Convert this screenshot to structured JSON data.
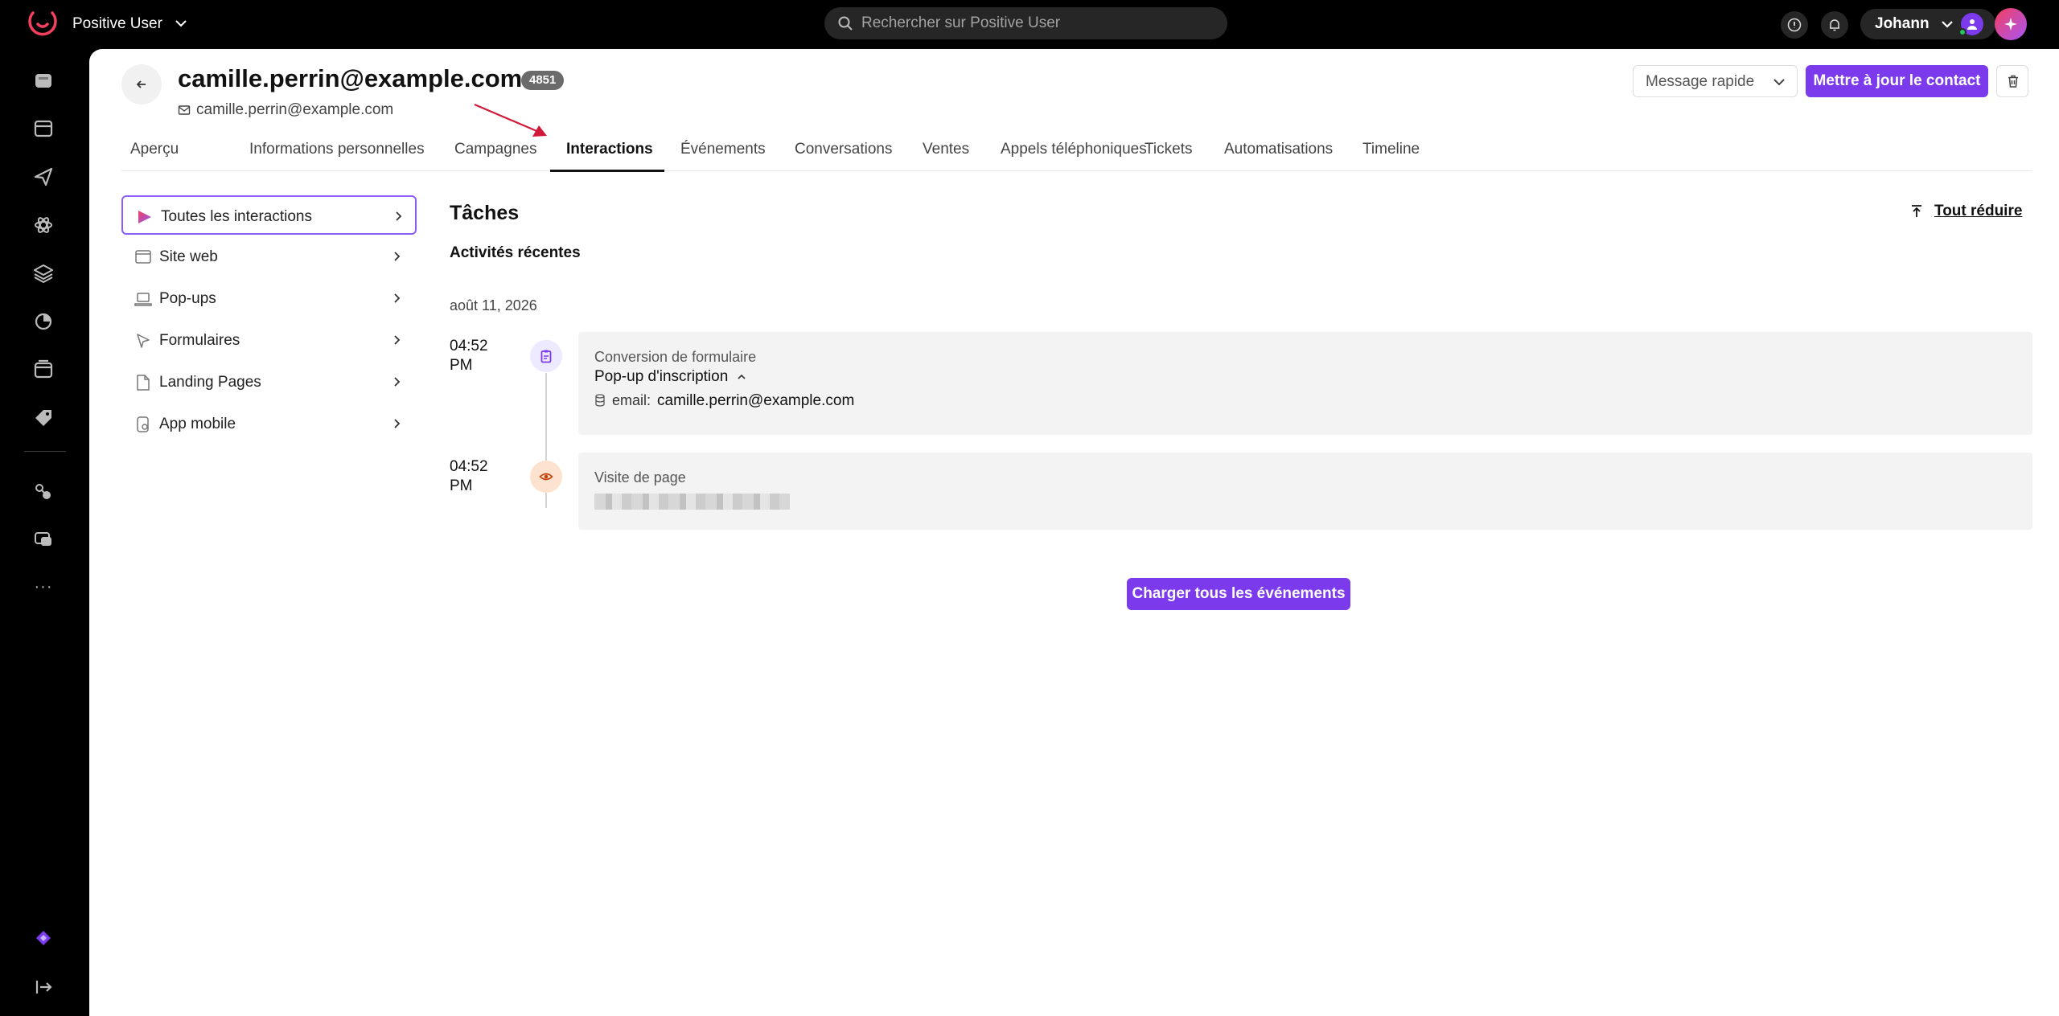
{
  "topbar": {
    "app_name": "Positive User",
    "search_placeholder": "Rechercher sur Positive User",
    "user_name": "Johann"
  },
  "rail": {
    "items": [
      "home-icon",
      "inbox-icon",
      "send-icon",
      "atom-icon",
      "layers-icon",
      "chart-pie-icon",
      "browser-window-icon",
      "tags-icon",
      "automation-icon",
      "chat-support-icon"
    ],
    "more_label": "···"
  },
  "contact": {
    "title": "camille.perrin@example.com",
    "id_badge": "4851",
    "email": "camille.perrin@example.com"
  },
  "actions": {
    "quick_message": "Message rapide",
    "update_contact": "Mettre à jour le contact"
  },
  "tabs": [
    {
      "label": "Aperçu"
    },
    {
      "label": "Informations personnelles"
    },
    {
      "label": "Campagnes"
    },
    {
      "label": "Interactions",
      "active": true
    },
    {
      "label": "Événements"
    },
    {
      "label": "Conversations"
    },
    {
      "label": "Ventes"
    },
    {
      "label": "Appels téléphoniques"
    },
    {
      "label": "Tickets"
    },
    {
      "label": "Automatisations"
    },
    {
      "label": "Timeline"
    }
  ],
  "sidebar": {
    "items": [
      {
        "label": "Toutes les interactions",
        "icon": "play-gradient-icon",
        "active": true
      },
      {
        "label": "Site web",
        "icon": "browser-icon"
      },
      {
        "label": "Pop-ups",
        "icon": "popup-icon"
      },
      {
        "label": "Formulaires",
        "icon": "form-icon"
      },
      {
        "label": "Landing Pages",
        "icon": "page-icon"
      },
      {
        "label": "App mobile",
        "icon": "mobile-app-icon"
      }
    ]
  },
  "content": {
    "section_title": "Tâches",
    "collapse_all": "Tout réduire",
    "recent_label": "Activités récentes",
    "date": "août 11, 2026",
    "events": [
      {
        "time": "04:52 PM",
        "type": "Conversion de formulaire",
        "name": "Pop-up d'inscription",
        "field_key": "email:",
        "field_value": "camille.perrin@example.com",
        "icon": "clipboard-icon",
        "icon_color": "#7c3aed"
      },
      {
        "time": "04:52 PM",
        "type": "Visite de page",
        "icon": "eye-icon",
        "icon_color": "#c2410c"
      }
    ],
    "load_all": "Charger tous les événements"
  },
  "colors": {
    "accent": "#7c3aed",
    "annotation_arrow": "#d11a3a"
  }
}
